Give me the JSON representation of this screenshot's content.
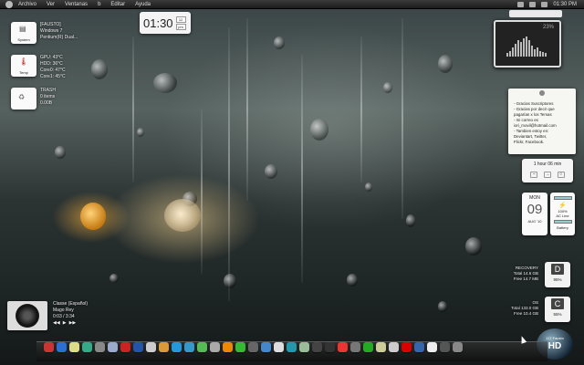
{
  "menubar": {
    "items": [
      "Archivo",
      "Ver",
      "Ventanas",
      "b",
      "Editar",
      "Ayuda"
    ],
    "time": "01:30 PM"
  },
  "clock": {
    "time": "01:30",
    "ampm_top": "12",
    "ampm": "pm"
  },
  "system_widget": {
    "label": "System",
    "lines": [
      "[FAUSTO]",
      "Windows 7",
      "Pentium(R) Dual..."
    ]
  },
  "temp_widget": {
    "label": "Temp",
    "lines": [
      "GPU: 43°C",
      "HDD: 36°C",
      "Core0: 47°C",
      "Core1: 45°C"
    ]
  },
  "trash_widget": {
    "lines": [
      "TRASH",
      "0 items",
      "0.00B"
    ]
  },
  "monitor_widget": {
    "value": "23%"
  },
  "notes": {
    "lines": [
      "- Gracias Suscriptores",
      "- Gracias por decir que",
      "pagarían x los Temas",
      "- mi correo es",
      "iori_movil@hotmail.com",
      "- Tambien estoy en:",
      "Deviantart, Twitter,",
      "Flickr, Facebook."
    ]
  },
  "timer": {
    "label": "1 hour 06 min"
  },
  "calendar": {
    "weekday": "MON",
    "day": "09",
    "month_year": "AUG '10"
  },
  "battery": {
    "percent": "100%",
    "source": "AC Line",
    "label": "Battery",
    "level": 1.0
  },
  "drives": [
    {
      "title": "RECOVERY",
      "total": "Total 14.6 GB",
      "free": "Free 14.7 MB",
      "letter": "D",
      "percent": "95%"
    },
    {
      "title": "OS",
      "total": "Total 133.0 GB",
      "free": "Free 10.4 GB",
      "letter": "C",
      "percent": "55%"
    }
  ],
  "hd_badge": {
    "top": "117 Fausto",
    "label": "HD"
  },
  "music": {
    "title": "Classe (Español)",
    "artist": "Mago Rey",
    "time": "0:03 / 3:34",
    "controls": [
      "◀◀",
      "▶",
      "▶▶"
    ]
  },
  "dock": {
    "icons": [
      "#c33",
      "#2a6fd6",
      "#dd8",
      "#3a8",
      "#888",
      "#9ac",
      "#c22",
      "#25a",
      "#ccc",
      "#d93",
      "#29d",
      "#39c",
      "#5b5",
      "#aaa",
      "#e80",
      "#3b3",
      "#666",
      "#48c",
      "#ddd",
      "#29a",
      "#9b9",
      "#444",
      "#333",
      "#e33",
      "#777",
      "#2a2",
      "#cc9",
      "#ccc",
      "#d00",
      "#36a",
      "#eee",
      "#555",
      "#888"
    ]
  }
}
